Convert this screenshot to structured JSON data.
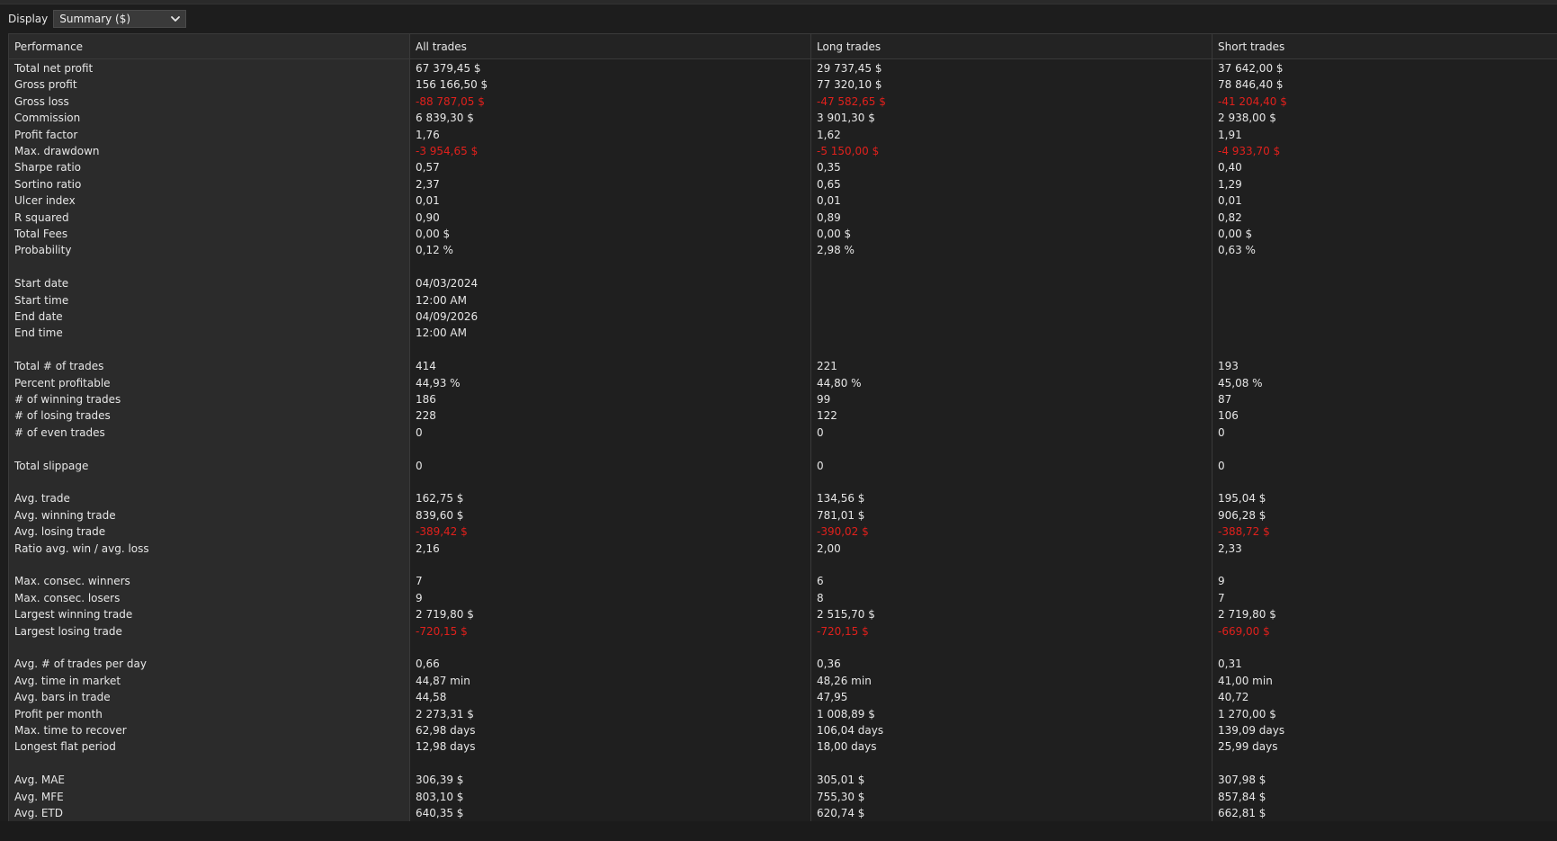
{
  "toolbar": {
    "display_label": "Display",
    "display_value": "Summary ($)",
    "dropdown_icon": "chevron-down-icon"
  },
  "colors": {
    "negative": "#e0201c",
    "text": "#e6e6e6",
    "label_column_bg": "#2b2b2b"
  },
  "table": {
    "headers": [
      "Performance",
      "All trades",
      "Long trades",
      "Short trades"
    ],
    "rows": [
      {
        "label": "Total net profit",
        "all": "67 379,45 $",
        "long": "29 737,45 $",
        "short": "37 642,00 $"
      },
      {
        "label": "Gross profit",
        "all": "156 166,50 $",
        "long": "77 320,10 $",
        "short": "78 846,40 $"
      },
      {
        "label": "Gross loss",
        "all": "-88 787,05 $",
        "long": "-47 582,65 $",
        "short": "-41 204,40 $",
        "neg": true
      },
      {
        "label": "Commission",
        "all": "6 839,30 $",
        "long": "3 901,30 $",
        "short": "2 938,00 $"
      },
      {
        "label": "Profit factor",
        "all": "1,76",
        "long": "1,62",
        "short": "1,91"
      },
      {
        "label": "Max. drawdown",
        "all": "-3 954,65 $",
        "long": "-5 150,00 $",
        "short": "-4 933,70 $",
        "neg": true
      },
      {
        "label": "Sharpe ratio",
        "all": "0,57",
        "long": "0,35",
        "short": "0,40"
      },
      {
        "label": "Sortino ratio",
        "all": "2,37",
        "long": "0,65",
        "short": "1,29"
      },
      {
        "label": "Ulcer index",
        "all": "0,01",
        "long": "0,01",
        "short": "0,01"
      },
      {
        "label": "R squared",
        "all": "0,90",
        "long": "0,89",
        "short": "0,82"
      },
      {
        "label": "Total Fees",
        "all": "0,00 $",
        "long": "0,00 $",
        "short": "0,00 $"
      },
      {
        "label": "Probability",
        "all": "0,12 %",
        "long": "2,98 %",
        "short": "0,63 %"
      },
      {
        "label": "",
        "all": "",
        "long": "",
        "short": ""
      },
      {
        "label": "Start date",
        "all": "04/03/2024",
        "long": "",
        "short": ""
      },
      {
        "label": "Start time",
        "all": "12:00 AM",
        "long": "",
        "short": ""
      },
      {
        "label": "End date",
        "all": "04/09/2026",
        "long": "",
        "short": ""
      },
      {
        "label": "End time",
        "all": "12:00 AM",
        "long": "",
        "short": ""
      },
      {
        "label": "",
        "all": "",
        "long": "",
        "short": ""
      },
      {
        "label": "Total # of trades",
        "all": "414",
        "long": "221",
        "short": "193"
      },
      {
        "label": "Percent profitable",
        "all": "44,93 %",
        "long": "44,80 %",
        "short": "45,08 %"
      },
      {
        "label": "# of winning trades",
        "all": "186",
        "long": "99",
        "short": "87"
      },
      {
        "label": "# of losing trades",
        "all": "228",
        "long": "122",
        "short": "106"
      },
      {
        "label": "# of even trades",
        "all": "0",
        "long": "0",
        "short": "0"
      },
      {
        "label": "",
        "all": "",
        "long": "",
        "short": ""
      },
      {
        "label": "Total slippage",
        "all": "0",
        "long": "0",
        "short": "0"
      },
      {
        "label": "",
        "all": "",
        "long": "",
        "short": ""
      },
      {
        "label": "Avg. trade",
        "all": "162,75 $",
        "long": "134,56 $",
        "short": "195,04 $"
      },
      {
        "label": "Avg. winning trade",
        "all": "839,60 $",
        "long": "781,01 $",
        "short": "906,28 $"
      },
      {
        "label": "Avg. losing trade",
        "all": "-389,42 $",
        "long": "-390,02 $",
        "short": "-388,72 $",
        "neg": true
      },
      {
        "label": "Ratio avg. win / avg. loss",
        "all": "2,16",
        "long": "2,00",
        "short": "2,33"
      },
      {
        "label": "",
        "all": "",
        "long": "",
        "short": ""
      },
      {
        "label": "Max. consec. winners",
        "all": "7",
        "long": "6",
        "short": "9"
      },
      {
        "label": "Max. consec. losers",
        "all": "9",
        "long": "8",
        "short": "7"
      },
      {
        "label": "Largest winning trade",
        "all": "2 719,80 $",
        "long": "2 515,70 $",
        "short": "2 719,80 $"
      },
      {
        "label": "Largest losing trade",
        "all": "-720,15 $",
        "long": "-720,15 $",
        "short": "-669,00 $",
        "neg": true
      },
      {
        "label": "",
        "all": "",
        "long": "",
        "short": ""
      },
      {
        "label": "Avg. # of trades per day",
        "all": "0,66",
        "long": "0,36",
        "short": "0,31"
      },
      {
        "label": "Avg. time in market",
        "all": "44,87 min",
        "long": "48,26 min",
        "short": "41,00 min"
      },
      {
        "label": "Avg. bars in trade",
        "all": "44,58",
        "long": "47,95",
        "short": "40,72"
      },
      {
        "label": "Profit per month",
        "all": "2 273,31 $",
        "long": "1 008,89 $",
        "short": "1 270,00 $"
      },
      {
        "label": "Max. time to recover",
        "all": "62,98 days",
        "long": "106,04 days",
        "short": "139,09 days"
      },
      {
        "label": "Longest flat period",
        "all": "12,98 days",
        "long": "18,00 days",
        "short": "25,99 days"
      },
      {
        "label": "",
        "all": "",
        "long": "",
        "short": ""
      },
      {
        "label": "Avg. MAE",
        "all": "306,39 $",
        "long": "305,01 $",
        "short": "307,98 $"
      },
      {
        "label": "Avg. MFE",
        "all": "803,10 $",
        "long": "755,30 $",
        "short": "857,84 $"
      },
      {
        "label": "Avg. ETD",
        "all": "640,35 $",
        "long": "620,74 $",
        "short": "662,81 $"
      }
    ]
  }
}
